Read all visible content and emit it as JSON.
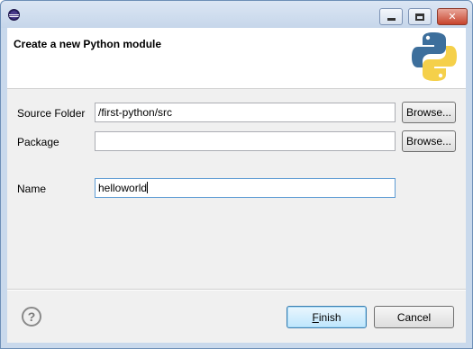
{
  "window": {
    "title": "",
    "icon": "eclipse-icon",
    "controls": [
      "minimize-icon",
      "maximize-icon",
      "close-icon"
    ],
    "close_glyph": "✕"
  },
  "banner": {
    "title": "Create a new Python module",
    "logo": "python-logo"
  },
  "form": {
    "source_folder": {
      "label": "Source Folder",
      "value": "/first-python/src",
      "browse_label": "Browse..."
    },
    "package": {
      "label": "Package",
      "value": "",
      "browse_label": "Browse..."
    },
    "name": {
      "label": "Name",
      "value": "helloworld"
    }
  },
  "footer": {
    "help_glyph": "?",
    "finish_label": "Finish",
    "finish_mnemonic": "F",
    "finish_rest": "inish",
    "cancel_label": "Cancel"
  },
  "colors": {
    "python_blue": "#3d6f9c",
    "python_yellow": "#f5d04a",
    "default_button": "#bee6fd"
  }
}
